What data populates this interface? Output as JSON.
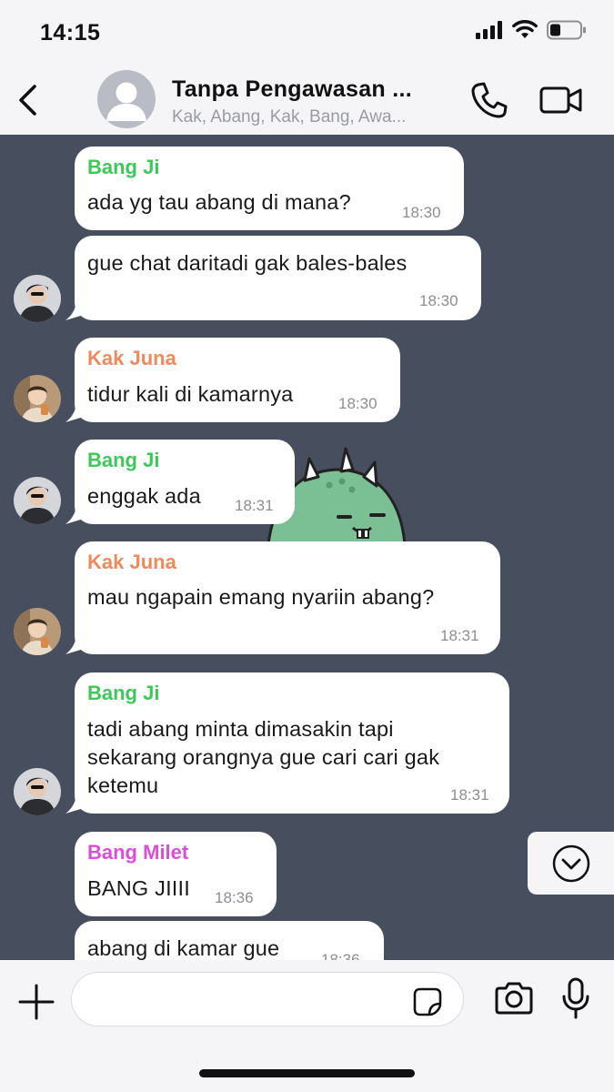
{
  "status_bar": {
    "time": "14:15"
  },
  "header": {
    "title": "Tanpa Pengawasan ...",
    "subtitle": "Kak, Abang, Kak, Bang, Awa..."
  },
  "colors": {
    "chat_bg": "#474e5d",
    "bang_ji": "#3ec85a",
    "kak_juna": "#f0895b",
    "bang_milet": "#d94fd6"
  },
  "messages": [
    {
      "sender": "Bang Ji",
      "text": "ada yg tau abang di mana?",
      "time": "18:30"
    },
    {
      "text": "gue chat daritadi gak bales-bales",
      "time": "18:30"
    },
    {
      "sender": "Kak Juna",
      "text": "tidur kali di kamarnya",
      "time": "18:30"
    },
    {
      "sender": "Bang Ji",
      "text": "enggak ada",
      "time": "18:31"
    },
    {
      "sender": "Kak Juna",
      "text": "mau ngapain emang nyariin abang?",
      "time": "18:31"
    },
    {
      "sender": "Bang Ji",
      "lines": [
        "tadi abang minta dimasakin tapi",
        "sekarang orangnya gue cari cari gak",
        "ketemu"
      ],
      "time": "18:31"
    },
    {
      "sender": "Bang Milet",
      "text": "BANG JIIII",
      "time": "18:36"
    },
    {
      "text": "abang di kamar gue",
      "time": "18:36"
    }
  ],
  "composer": {
    "placeholder": ""
  },
  "icons": {
    "back": "chevron-left-icon",
    "call": "phone-icon",
    "video": "video-camera-icon",
    "scroll": "chevron-down-circle-icon",
    "plus": "plus-icon",
    "sticker": "sticker-icon",
    "camera": "camera-icon",
    "mic": "microphone-icon"
  }
}
